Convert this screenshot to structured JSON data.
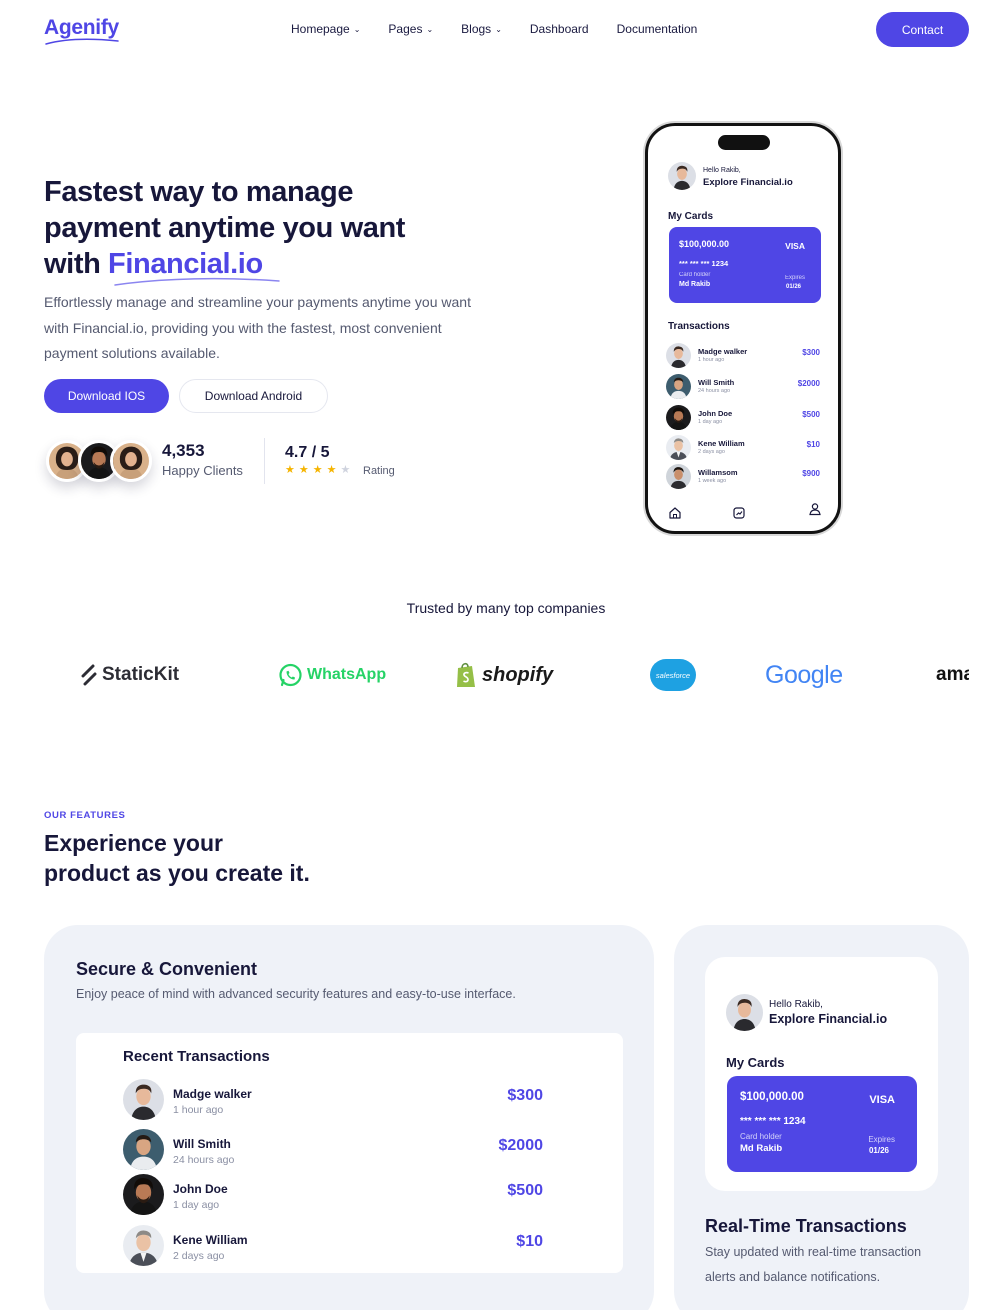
{
  "nav": {
    "logo": "Agenify",
    "menu": [
      {
        "label": "Homepage",
        "dropdown": true
      },
      {
        "label": "Pages",
        "dropdown": true
      },
      {
        "label": "Blogs",
        "dropdown": true
      },
      {
        "label": "Dashboard",
        "dropdown": false
      },
      {
        "label": "Documentation",
        "dropdown": false
      }
    ],
    "contact_label": "Contact"
  },
  "hero": {
    "title_line1": "Fastest way to manage",
    "title_line2": "payment anytime you want",
    "title_line3_prefix": "with ",
    "title_accent": "Financial.io",
    "description": "Effortlessly manage and streamline your payments anytime you want with Financial.io, providing you with the fastest, most convenient payment solutions available.",
    "btn_ios": "Download IOS",
    "btn_android": "Download Android",
    "clients_count": "4,353",
    "clients_label": "Happy Clients",
    "rating_value": "4.7 / 5",
    "rating_label": "Rating",
    "stars_filled": 4,
    "stars_total": 5
  },
  "phone": {
    "hello": "Hello Rakib,",
    "explore": "Explore Financial.io",
    "my_cards": "My Cards",
    "card": {
      "amount": "$100,000.00",
      "brand": "VISA",
      "number": "*** *** *** 1234",
      "holder_label": "Card holder",
      "holder_name": "Md Rakib",
      "expires_label": "Expires",
      "expires_date": "01/26"
    },
    "transactions_label": "Transactions",
    "transactions": [
      {
        "name": "Madge walker",
        "time": "1 hour ago",
        "amount": "$300"
      },
      {
        "name": "Will Smith",
        "time": "24 hours ago",
        "amount": "$2000"
      },
      {
        "name": "John Doe",
        "time": "1 day ago",
        "amount": "$500"
      },
      {
        "name": "Kene William",
        "time": "2 days ago",
        "amount": "$10"
      },
      {
        "name": "Willamsom",
        "time": "1 week ago",
        "amount": "$900"
      }
    ],
    "tab_icons": [
      "home-icon",
      "chart-icon",
      "user-icon"
    ]
  },
  "trusted": {
    "heading": "Trusted by many top companies",
    "brands": [
      "StaticKit",
      "WhatsApp",
      "shopify",
      "salesforce",
      "Google",
      "ama"
    ]
  },
  "features": {
    "tag": "OUR FEATURES",
    "title_line1": "Experience your",
    "title_line2": "product as you create it.",
    "secure": {
      "title": "Secure & Convenient",
      "description": "Enjoy peace of mind with advanced security features and easy-to-use interface.",
      "panel_title": "Recent Transactions",
      "rows": [
        {
          "name": "Madge walker",
          "time": "1 hour ago",
          "amount": "$300"
        },
        {
          "name": "Will Smith",
          "time": "24 hours ago",
          "amount": "$2000"
        },
        {
          "name": "John Doe",
          "time": "1 day ago",
          "amount": "$500"
        },
        {
          "name": "Kene William",
          "time": "2 days ago",
          "amount": "$10"
        }
      ]
    },
    "realtime": {
      "hello": "Hello Rakib,",
      "explore": "Explore Financial.io",
      "my_cards": "My Cards",
      "card": {
        "amount": "$100,000.00",
        "brand": "VISA",
        "number": "*** *** *** 1234",
        "holder_label": "Card holder",
        "holder_name": "Md Rakib",
        "expires_label": "Expires",
        "expires_date": "01/26"
      },
      "title": "Real-Time Transactions",
      "description": "Stay updated with real-time transaction alerts and balance notifications."
    }
  },
  "colors": {
    "accent": "#4f46e5",
    "heading": "#17173a",
    "body": "#555a70",
    "card_bg": "#eff2f8",
    "star": "#f5b400"
  }
}
